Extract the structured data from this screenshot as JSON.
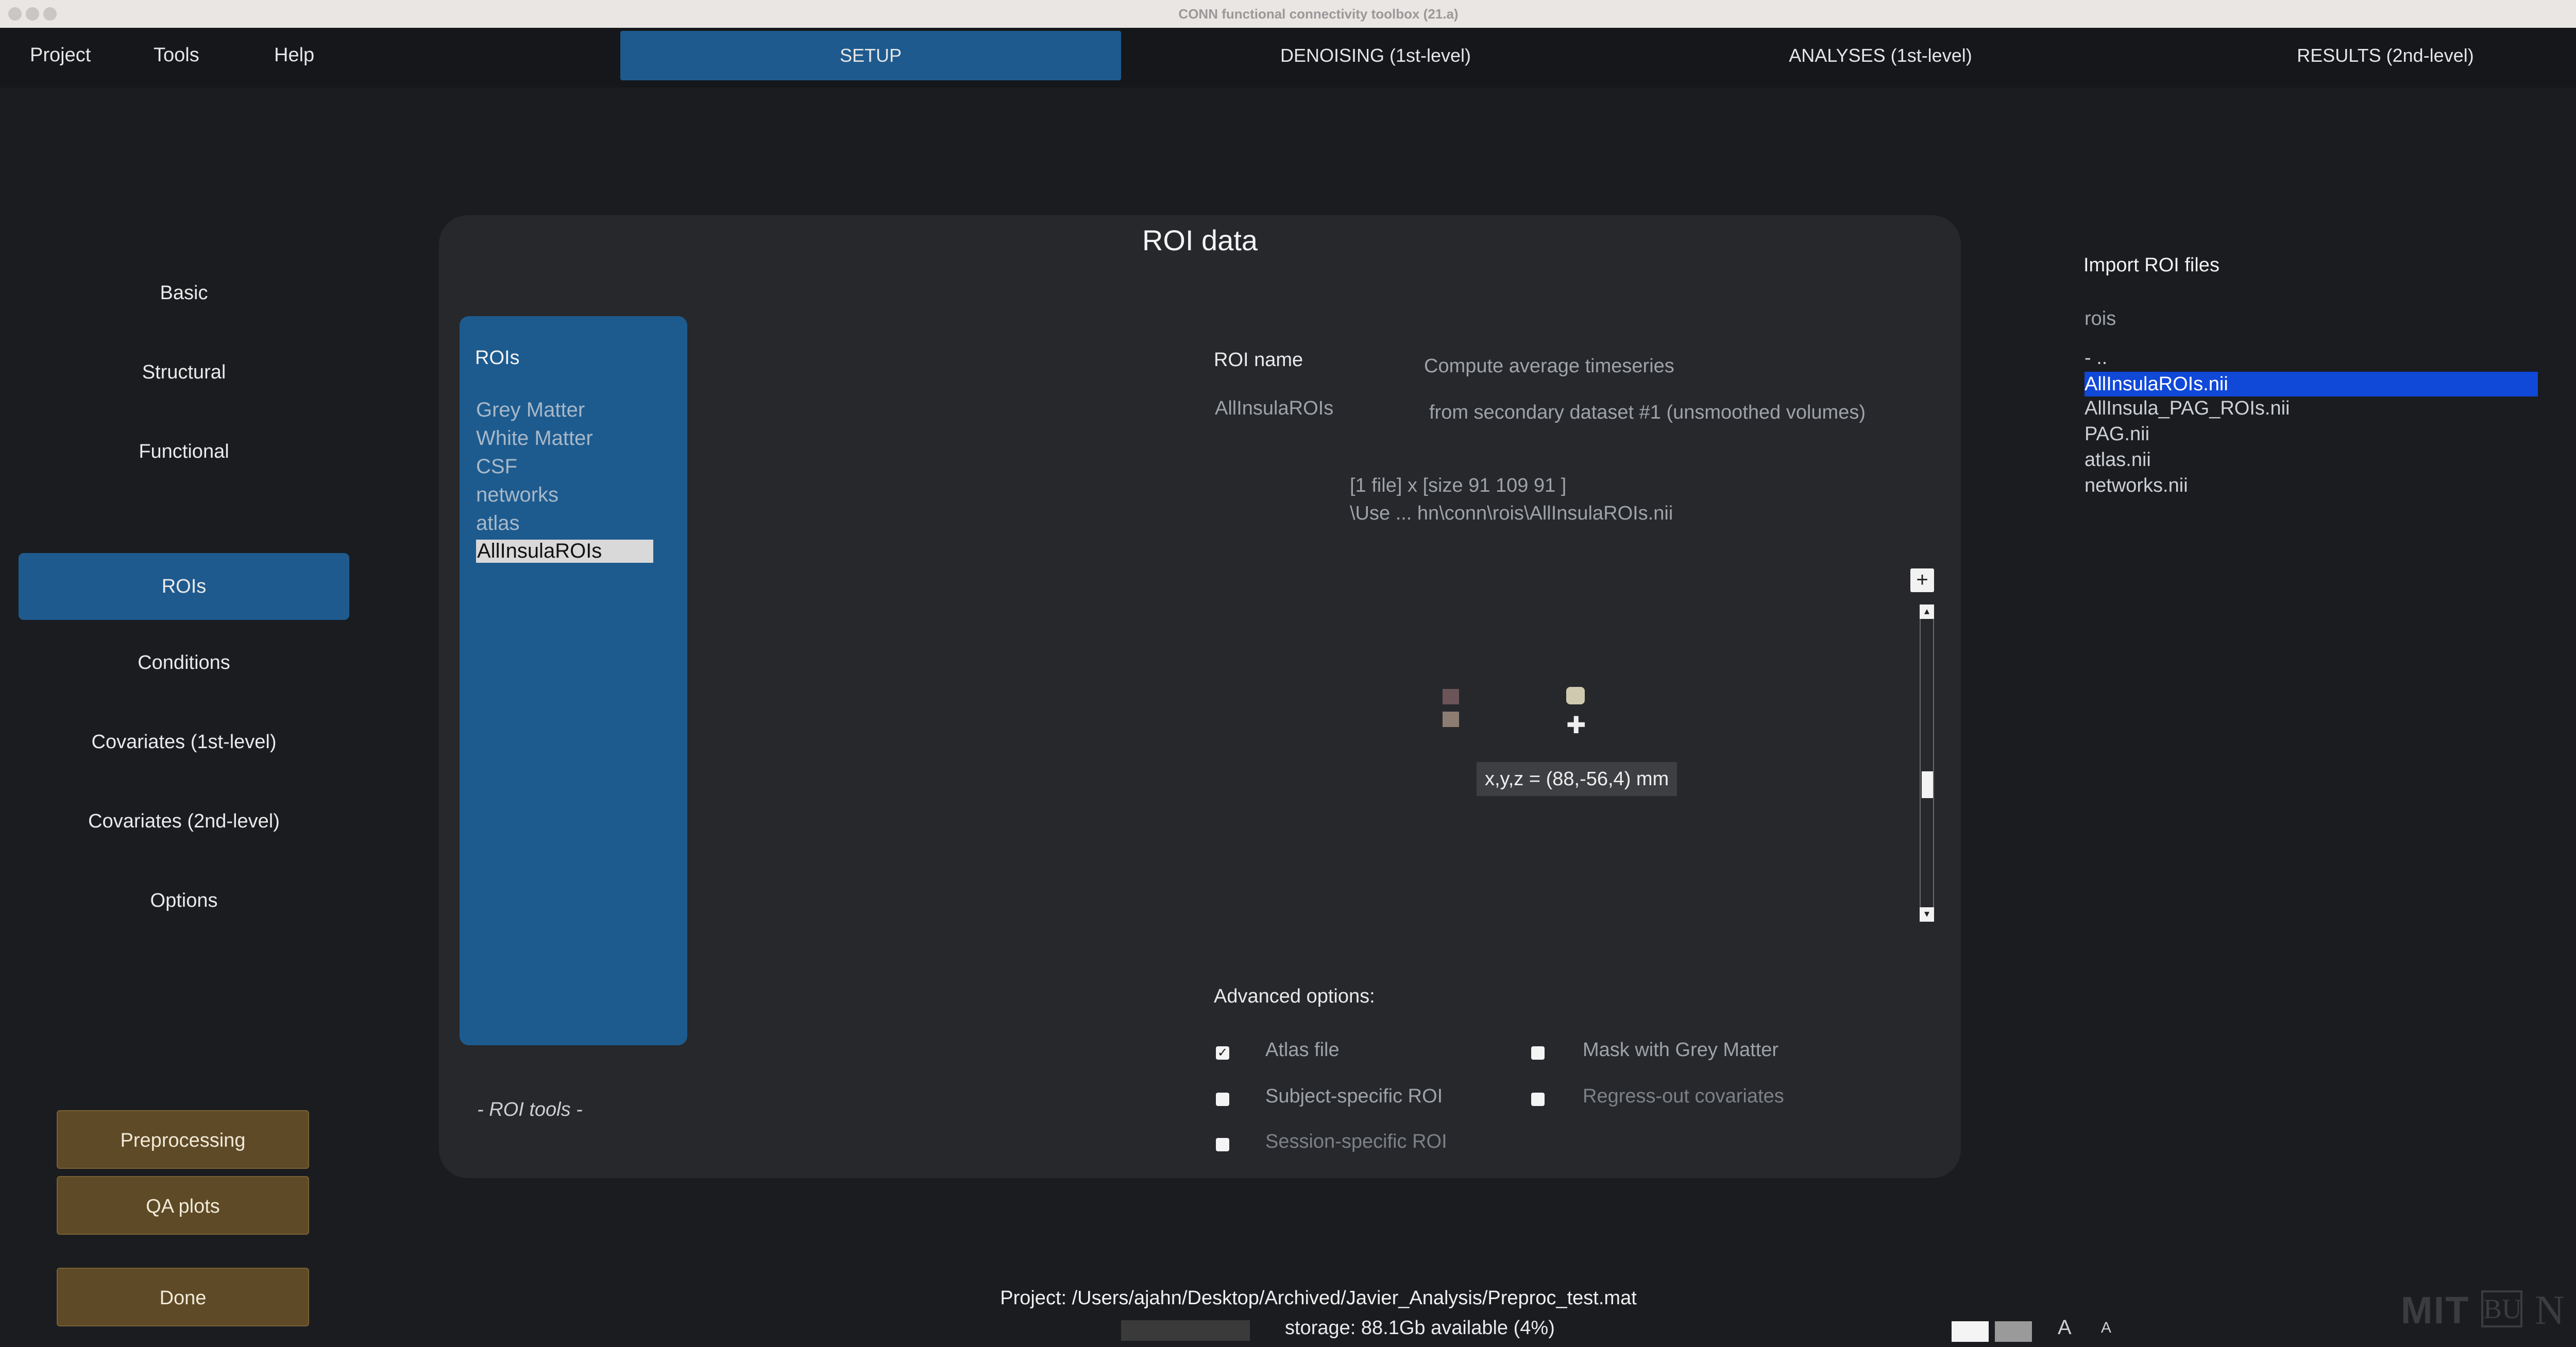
{
  "window": {
    "title": "CONN functional connectivity toolbox (21.a)"
  },
  "menu": {
    "project": "Project",
    "tools": "Tools",
    "help": "Help"
  },
  "tabs": {
    "setup": "SETUP",
    "denoising": "DENOISING (1st-level)",
    "analyses": "ANALYSES (1st-level)",
    "results": "RESULTS (2nd-level)"
  },
  "sidebar": {
    "basic": "Basic",
    "structural": "Structural",
    "functional": "Functional",
    "rois": "ROIs",
    "conditions": "Conditions",
    "covariates1": "Covariates (1st-level)",
    "covariates2": "Covariates (2nd-level)",
    "options": "Options"
  },
  "actions": {
    "preprocessing": "Preprocessing",
    "qa_plots": "QA plots",
    "done": "Done"
  },
  "panel": {
    "title": "ROI data"
  },
  "rois": {
    "header": "ROIs",
    "items": [
      "Grey Matter",
      "White Matter",
      "CSF",
      "networks",
      "atlas",
      "AllInsulaROIs"
    ],
    "tools": "- ROI tools -"
  },
  "roi_info": {
    "name_label": "ROI name",
    "name_value": "AllInsulaROIs",
    "compute_label": "Compute average timeseries",
    "source": "from secondary dataset #1 (unsmoothed volumes)",
    "file_info": "[1 file] x [size 91 109 91 ]",
    "file_path": "\\Use ... hn\\conn\\rois\\AllInsulaROIs.nii"
  },
  "viewer": {
    "coords": "x,y,z = (88,-56,4) mm",
    "zoom_in": "+"
  },
  "advanced": {
    "title": "Advanced options:",
    "atlas_file": "Atlas file",
    "mask_grey": "Mask with Grey Matter",
    "subject_specific": "Subject-specific ROI",
    "regress_out": "Regress-out covariates",
    "session_specific": "Session-specific ROI"
  },
  "import": {
    "title": "Import ROI files",
    "folder": "rois",
    "files": [
      "- ..",
      "AllInsulaROIs.nii",
      "AllInsula_PAG_ROIs.nii",
      "PAG.nii",
      "atlas.nii",
      "networks.nii"
    ]
  },
  "footer": {
    "project": "Project: /Users/ajahn/Desktop/Archived/Javier_Analysis/Preproc_test.mat",
    "storage": "storage: 88.1Gb available (4%)",
    "font_large": "A",
    "font_small": "A"
  },
  "logos": {
    "mit": "MIT",
    "bu": "BU",
    "n": "N"
  },
  "colors": {
    "background": "#1a1c20",
    "accent_blue": "#1f5a8e",
    "selected_file": "#1048d8",
    "brown_button": "#5e4a26",
    "panel": "#26282c"
  }
}
